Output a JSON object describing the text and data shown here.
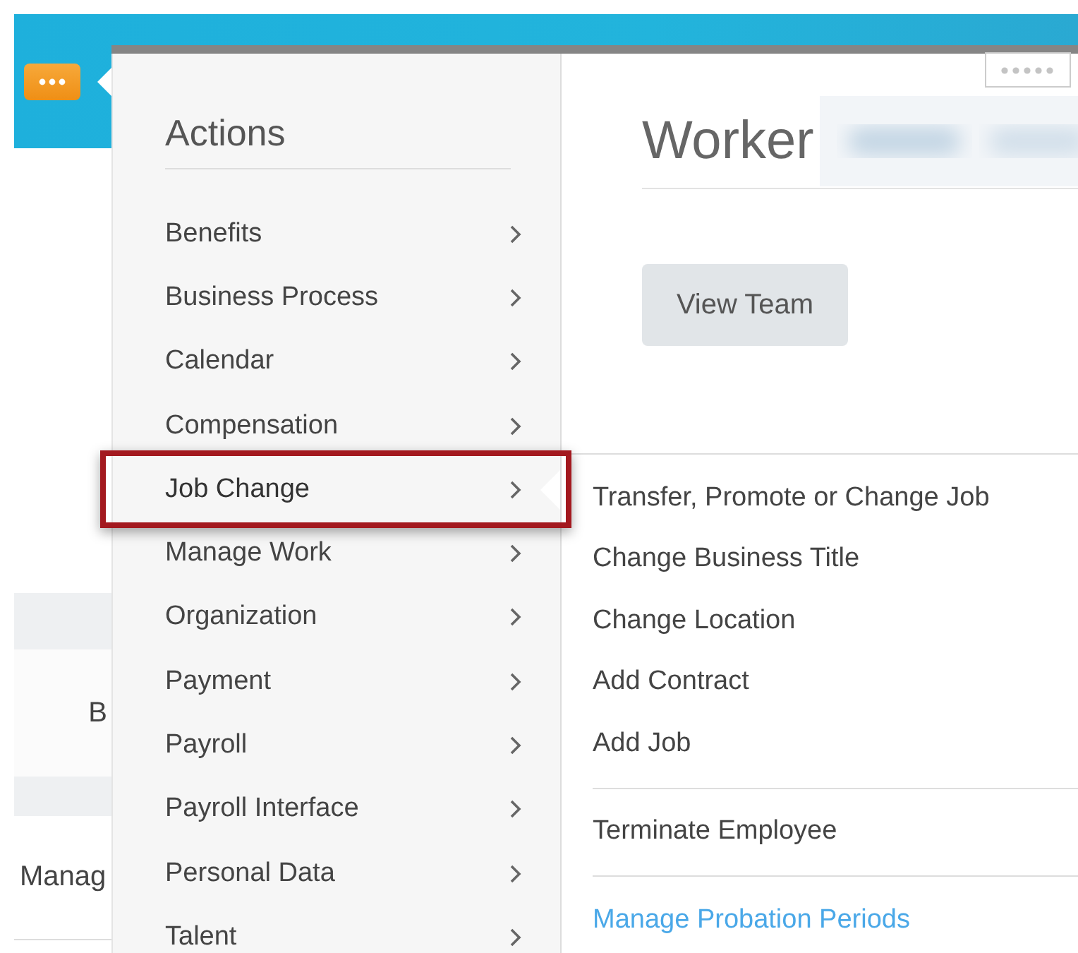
{
  "background": {
    "cells": [
      "B",
      "Manag"
    ]
  },
  "actions_menu": {
    "title": "Actions",
    "items": [
      {
        "label": "Benefits",
        "selected": false
      },
      {
        "label": "Business Process",
        "selected": false
      },
      {
        "label": "Calendar",
        "selected": false
      },
      {
        "label": "Compensation",
        "selected": false
      },
      {
        "label": "Job Change",
        "selected": true
      },
      {
        "label": "Manage Work",
        "selected": false
      },
      {
        "label": "Organization",
        "selected": false
      },
      {
        "label": "Payment",
        "selected": false
      },
      {
        "label": "Payroll",
        "selected": false
      },
      {
        "label": "Payroll Interface",
        "selected": false
      },
      {
        "label": "Personal Data",
        "selected": false
      },
      {
        "label": "Talent",
        "selected": false
      }
    ]
  },
  "worker_card": {
    "title": "Worker",
    "button": "View Team"
  },
  "submenu": {
    "groups": [
      {
        "items": [
          {
            "label": "Transfer, Promote or Change Job",
            "kind": "action"
          },
          {
            "label": "Change Business Title",
            "kind": "action"
          },
          {
            "label": "Change Location",
            "kind": "action"
          },
          {
            "label": "Add Contract",
            "kind": "action"
          },
          {
            "label": "Add Job",
            "kind": "action"
          }
        ]
      },
      {
        "items": [
          {
            "label": "Terminate Employee",
            "kind": "action"
          }
        ]
      },
      {
        "items": [
          {
            "label": "Manage Probation Periods",
            "kind": "link"
          }
        ]
      }
    ]
  }
}
